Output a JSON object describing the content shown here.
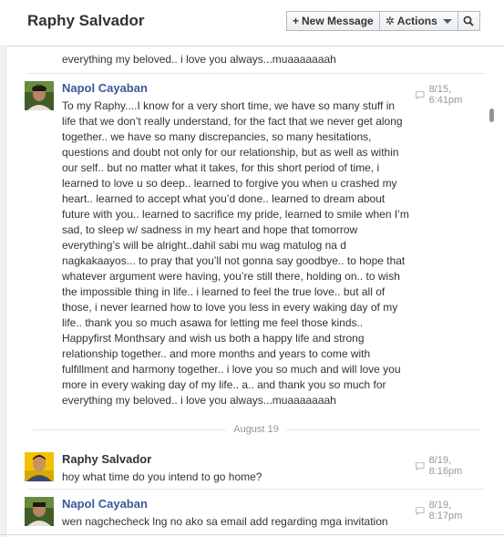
{
  "header": {
    "title": "Raphy Salvador",
    "new_message_label": "New Message",
    "new_message_icon": "plus-icon",
    "actions_label": "Actions",
    "actions_icon": "gear-icon",
    "search_icon": "search-icon"
  },
  "top_fragment": {
    "text": "everything my beloved.. i love you always...muaaaaaaah"
  },
  "messages": [
    {
      "author": "Napol Cayaban",
      "time": "8/15, 6:41pm",
      "body": "To my Raphy....I know for a very short time, we have so many stuff in\nlife that we don’t really understand, for the fact that we never get along\ntogether.. we have so many discrepancies, so many hesitations,\nquestions and doubt not only for our relationship, but as well as within\nour self.. but no matter what it takes, for this short period of time, i\nlearned to love u so deep.. learned to forgive you when u crashed my\nheart.. learned to accept what you’d done.. learned to dream about\nfuture with you.. learned to sacrifice my pride, learned to smile when I’m\nsad, to sleep w/ sadness in my heart and hope that tomorrow\neverything’s will be alright..dahil sabi mu wag matulog na d\nnagkakaayos... to pray that you’ll not gonna say goodbye.. to hope that\nwhatever argument were having, you’re still there, holding on.. to wish\nthe impossible thing in life.. i learned to feel the true love.. but all of\nthose, i never learned how to love you less in every waking day of my\nlife.. thank you so much asawa for letting me feel those kinds..\nHappyfirst Monthsary  and wish us both a happy life and strong\nrelationship together.. and more months and years to come with\nfulfillment and harmony together.. i love you so much  and will love you\nmore in every waking day of my life.. a.. and thank you so much for\neverything my beloved.. i love you always...muaaaaaaah"
    },
    {
      "author": "Raphy Salvador",
      "time": "8/19, 8:16pm",
      "body": "hoy what time do you intend to go home?"
    },
    {
      "author": "Napol Cayaban",
      "time": "8/19, 8:17pm",
      "body": "wen nagchecheck lng no ako sa email add regarding mga invitation"
    }
  ],
  "date_separator": "August 19",
  "colors": {
    "link_blue": "#3b5998",
    "text": "#333333",
    "meta_gray": "#9197a3",
    "divider": "#e5e6e9"
  }
}
